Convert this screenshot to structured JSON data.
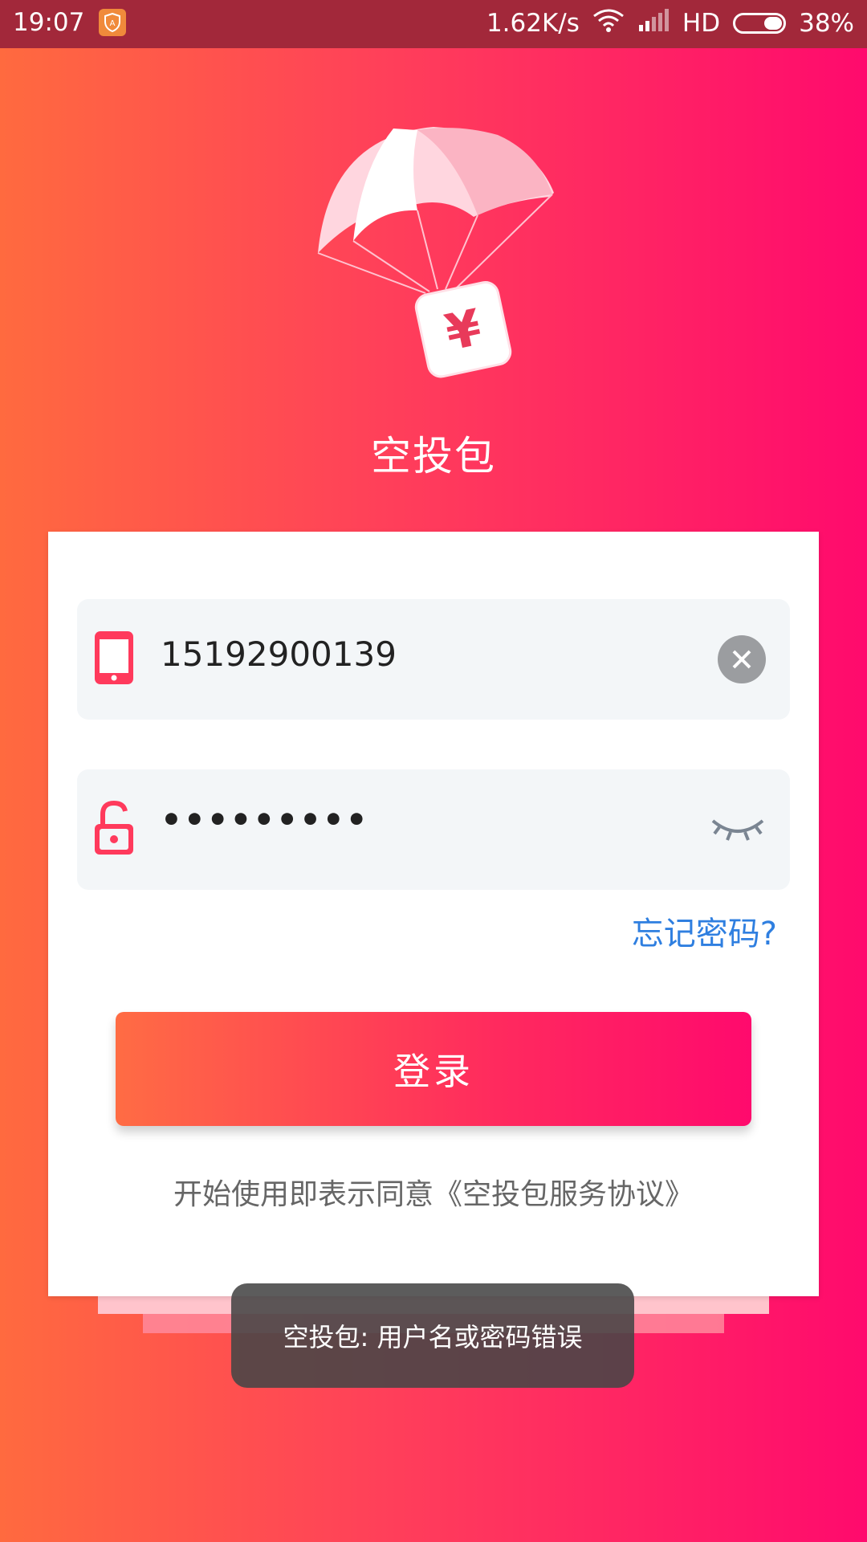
{
  "status_bar": {
    "time": "19:07",
    "network_speed": "1.62K/s",
    "network_type": "HD",
    "battery": "38%"
  },
  "app": {
    "name": "空投包",
    "logo_icon": "parachute-yen-icon"
  },
  "login_form": {
    "phone": {
      "value": "15192900139",
      "icon": "phone-icon"
    },
    "password": {
      "value": "•••••••••",
      "icon": "lock-icon"
    },
    "forgot_password": "忘记密码?",
    "login_button": "登录",
    "agreement": "开始使用即表示同意《空投包服务协议》"
  },
  "toast": {
    "message": "空投包: 用户名或密码错误"
  },
  "colors": {
    "accent": "#ff1f64",
    "link": "#2f7fe0"
  }
}
